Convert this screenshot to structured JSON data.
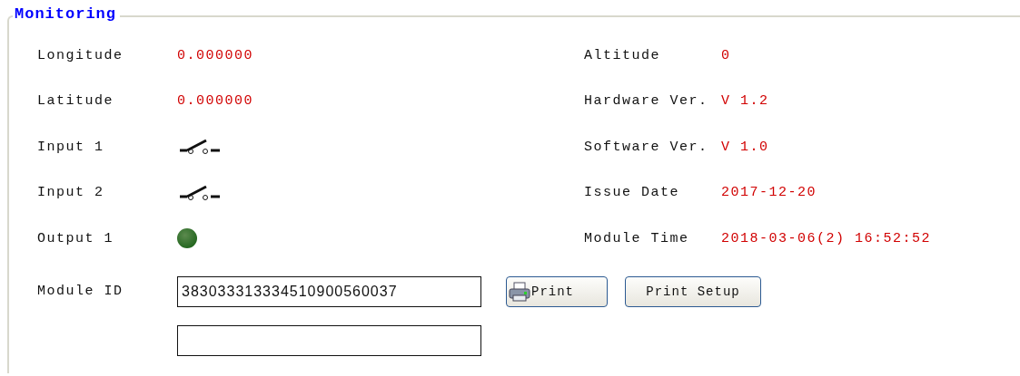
{
  "group": {
    "title": "Monitoring"
  },
  "left_rows": [
    {
      "label": "Longitude",
      "kind": "text",
      "value": "0.000000"
    },
    {
      "label": "Latitude",
      "kind": "text",
      "value": "0.000000"
    },
    {
      "label": "Input 1",
      "kind": "switch",
      "on": false
    },
    {
      "label": "Input 2",
      "kind": "switch",
      "on": false
    },
    {
      "label": "Output 1",
      "kind": "led",
      "on": false
    }
  ],
  "right_rows": [
    {
      "label": "Altitude",
      "value": "0"
    },
    {
      "label": "Hardware Ver.",
      "value": "V 1.2"
    },
    {
      "label": "Software Ver.",
      "value": "V 1.0"
    },
    {
      "label": "Issue Date",
      "value": "2017-12-20"
    },
    {
      "label": "Module Time",
      "value": "2018-03-06(2) 16:52:52"
    }
  ],
  "module_id": {
    "label": "Module ID",
    "value": "383033313334510900560037"
  },
  "buttons": [
    {
      "kind": "print",
      "label": "Print"
    },
    {
      "kind": "plain",
      "label": "Print Setup"
    }
  ]
}
